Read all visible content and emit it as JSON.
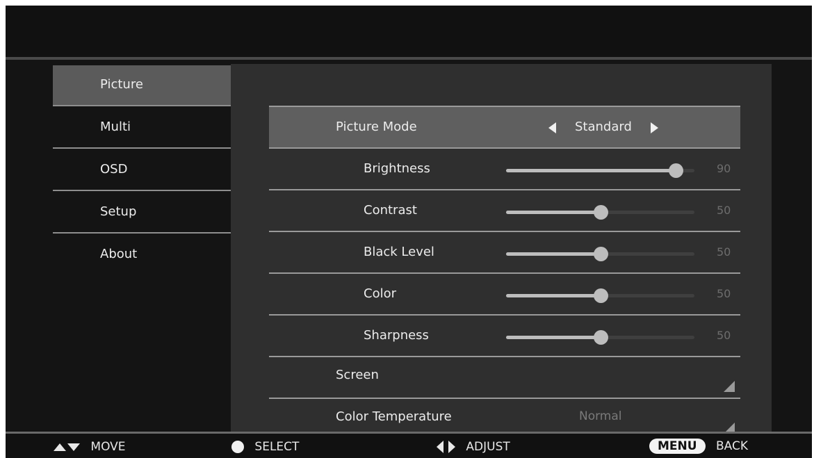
{
  "sidebar": {
    "items": [
      {
        "label": "Picture",
        "active": true
      },
      {
        "label": "Multi"
      },
      {
        "label": "OSD"
      },
      {
        "label": "Setup"
      },
      {
        "label": "About"
      }
    ]
  },
  "picture_mode": {
    "label": "Picture Mode",
    "value": "Standard"
  },
  "sliders": [
    {
      "label": "Brightness",
      "value": 90,
      "display": "90"
    },
    {
      "label": "Contrast",
      "value": 50,
      "display": "50"
    },
    {
      "label": "Black Level",
      "value": 50,
      "display": "50"
    },
    {
      "label": "Color",
      "value": 50,
      "display": "50"
    },
    {
      "label": "Sharpness",
      "value": 50,
      "display": "50"
    }
  ],
  "screen": {
    "label": "Screen"
  },
  "color_temperature": {
    "label": "Color Temperature",
    "value": "Normal"
  },
  "hints": {
    "move": "MOVE",
    "select": "SELECT",
    "adjust": "ADJUST",
    "menu": "MENU",
    "back": "BACK"
  },
  "colors": {
    "slider_fill": "#bdbdbd",
    "selected_row": "#5f5f5f",
    "panel": "#2f2f2f"
  }
}
